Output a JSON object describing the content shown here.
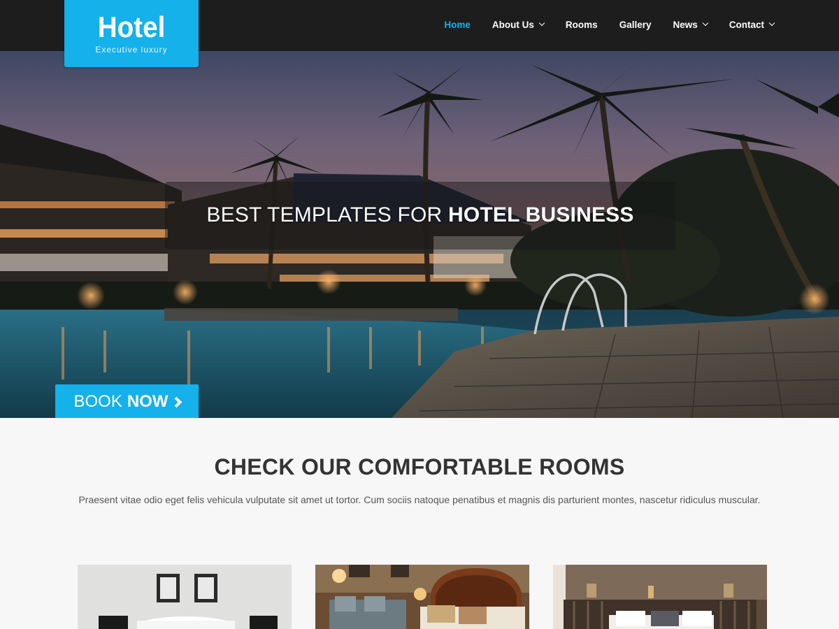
{
  "brand": {
    "title": "Hotel",
    "tagline": "Executive luxury",
    "accent": "#14b1ea"
  },
  "nav": {
    "items": [
      {
        "label": "Home",
        "active": true,
        "dropdown": false
      },
      {
        "label": "About Us",
        "active": false,
        "dropdown": true
      },
      {
        "label": "Rooms",
        "active": false,
        "dropdown": false
      },
      {
        "label": "Gallery",
        "active": false,
        "dropdown": false
      },
      {
        "label": "News",
        "active": false,
        "dropdown": true
      },
      {
        "label": "Contact",
        "active": false,
        "dropdown": true
      }
    ]
  },
  "hero": {
    "title_light": "BEST TEMPLATES FOR ",
    "title_bold": "HOTEL BUSINESS",
    "cta_light": "BOOK",
    "cta_bold": "NOW",
    "cta_icon": "chevron-right-icon"
  },
  "rooms": {
    "heading_light": "CHECK OUR COMFORTABLE ",
    "heading_bold": "ROOMS",
    "description": "Praesent vitae odio eget felis vehicula vulputate sit amet ut tortor. Cum sociis natoque penatibus et magnis dis parturient montes, nascetur ridiculus muscular."
  },
  "colors": {
    "header_bg": "#1d1d1d",
    "page_bg": "#f7f7f7",
    "text_dark": "#333333"
  }
}
